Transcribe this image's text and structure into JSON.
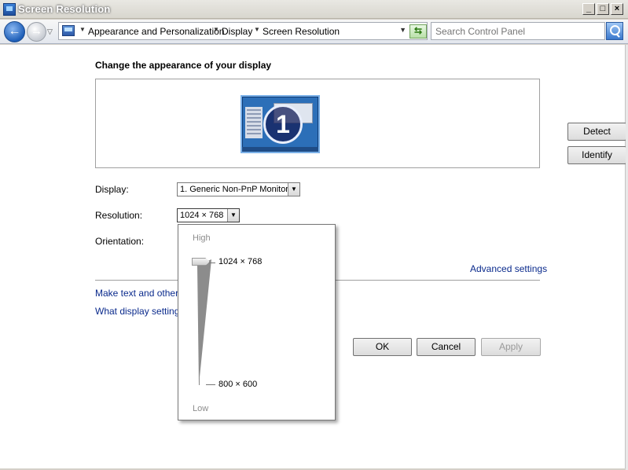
{
  "window": {
    "title": "Screen Resolution"
  },
  "address": {
    "breadcrumbs": [
      "Appearance and Personalization",
      "Display",
      "Screen Resolution"
    ],
    "search_placeholder": "Search Control Panel"
  },
  "main": {
    "heading": "Change the appearance of your display",
    "monitor_number": "1",
    "detect_label": "Detect",
    "identify_label": "Identify",
    "display_label": "Display:",
    "display_value": "1. Generic Non-PnP Monitor",
    "resolution_label": "Resolution:",
    "resolution_value": "1024 × 768",
    "orientation_label": "Orientation:",
    "advanced_link": "Advanced settings",
    "link_text_size": "Make text and other i",
    "link_display_settings": "What display settings",
    "ok_label": "OK",
    "cancel_label": "Cancel",
    "apply_label": "Apply"
  },
  "resolution_popup": {
    "high_label": "High",
    "low_label": "Low",
    "top_option": "1024 × 768",
    "bottom_option": "800 × 600",
    "selected": "1024 × 768"
  },
  "colors": {
    "link": "#0a2a8c",
    "monitor_blue": "#2c6fb8"
  }
}
